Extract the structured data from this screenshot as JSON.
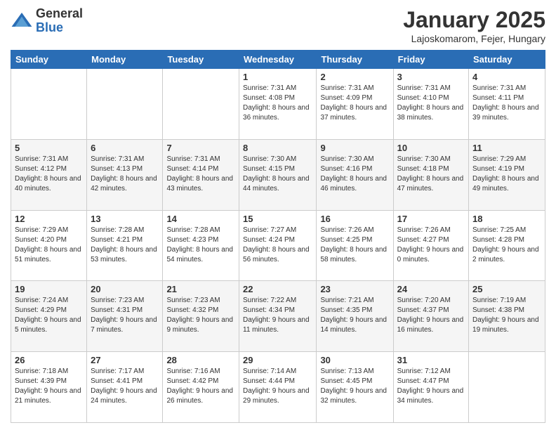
{
  "logo": {
    "general": "General",
    "blue": "Blue"
  },
  "title": "January 2025",
  "location": "Lajoskomarom, Fejer, Hungary",
  "days_of_week": [
    "Sunday",
    "Monday",
    "Tuesday",
    "Wednesday",
    "Thursday",
    "Friday",
    "Saturday"
  ],
  "weeks": [
    [
      {
        "day": "",
        "info": ""
      },
      {
        "day": "",
        "info": ""
      },
      {
        "day": "",
        "info": ""
      },
      {
        "day": "1",
        "info": "Sunrise: 7:31 AM\nSunset: 4:08 PM\nDaylight: 8 hours and 36 minutes."
      },
      {
        "day": "2",
        "info": "Sunrise: 7:31 AM\nSunset: 4:09 PM\nDaylight: 8 hours and 37 minutes."
      },
      {
        "day": "3",
        "info": "Sunrise: 7:31 AM\nSunset: 4:10 PM\nDaylight: 8 hours and 38 minutes."
      },
      {
        "day": "4",
        "info": "Sunrise: 7:31 AM\nSunset: 4:11 PM\nDaylight: 8 hours and 39 minutes."
      }
    ],
    [
      {
        "day": "5",
        "info": "Sunrise: 7:31 AM\nSunset: 4:12 PM\nDaylight: 8 hours and 40 minutes."
      },
      {
        "day": "6",
        "info": "Sunrise: 7:31 AM\nSunset: 4:13 PM\nDaylight: 8 hours and 42 minutes."
      },
      {
        "day": "7",
        "info": "Sunrise: 7:31 AM\nSunset: 4:14 PM\nDaylight: 8 hours and 43 minutes."
      },
      {
        "day": "8",
        "info": "Sunrise: 7:30 AM\nSunset: 4:15 PM\nDaylight: 8 hours and 44 minutes."
      },
      {
        "day": "9",
        "info": "Sunrise: 7:30 AM\nSunset: 4:16 PM\nDaylight: 8 hours and 46 minutes."
      },
      {
        "day": "10",
        "info": "Sunrise: 7:30 AM\nSunset: 4:18 PM\nDaylight: 8 hours and 47 minutes."
      },
      {
        "day": "11",
        "info": "Sunrise: 7:29 AM\nSunset: 4:19 PM\nDaylight: 8 hours and 49 minutes."
      }
    ],
    [
      {
        "day": "12",
        "info": "Sunrise: 7:29 AM\nSunset: 4:20 PM\nDaylight: 8 hours and 51 minutes."
      },
      {
        "day": "13",
        "info": "Sunrise: 7:28 AM\nSunset: 4:21 PM\nDaylight: 8 hours and 53 minutes."
      },
      {
        "day": "14",
        "info": "Sunrise: 7:28 AM\nSunset: 4:23 PM\nDaylight: 8 hours and 54 minutes."
      },
      {
        "day": "15",
        "info": "Sunrise: 7:27 AM\nSunset: 4:24 PM\nDaylight: 8 hours and 56 minutes."
      },
      {
        "day": "16",
        "info": "Sunrise: 7:26 AM\nSunset: 4:25 PM\nDaylight: 8 hours and 58 minutes."
      },
      {
        "day": "17",
        "info": "Sunrise: 7:26 AM\nSunset: 4:27 PM\nDaylight: 9 hours and 0 minutes."
      },
      {
        "day": "18",
        "info": "Sunrise: 7:25 AM\nSunset: 4:28 PM\nDaylight: 9 hours and 2 minutes."
      }
    ],
    [
      {
        "day": "19",
        "info": "Sunrise: 7:24 AM\nSunset: 4:29 PM\nDaylight: 9 hours and 5 minutes."
      },
      {
        "day": "20",
        "info": "Sunrise: 7:23 AM\nSunset: 4:31 PM\nDaylight: 9 hours and 7 minutes."
      },
      {
        "day": "21",
        "info": "Sunrise: 7:23 AM\nSunset: 4:32 PM\nDaylight: 9 hours and 9 minutes."
      },
      {
        "day": "22",
        "info": "Sunrise: 7:22 AM\nSunset: 4:34 PM\nDaylight: 9 hours and 11 minutes."
      },
      {
        "day": "23",
        "info": "Sunrise: 7:21 AM\nSunset: 4:35 PM\nDaylight: 9 hours and 14 minutes."
      },
      {
        "day": "24",
        "info": "Sunrise: 7:20 AM\nSunset: 4:37 PM\nDaylight: 9 hours and 16 minutes."
      },
      {
        "day": "25",
        "info": "Sunrise: 7:19 AM\nSunset: 4:38 PM\nDaylight: 9 hours and 19 minutes."
      }
    ],
    [
      {
        "day": "26",
        "info": "Sunrise: 7:18 AM\nSunset: 4:39 PM\nDaylight: 9 hours and 21 minutes."
      },
      {
        "day": "27",
        "info": "Sunrise: 7:17 AM\nSunset: 4:41 PM\nDaylight: 9 hours and 24 minutes."
      },
      {
        "day": "28",
        "info": "Sunrise: 7:16 AM\nSunset: 4:42 PM\nDaylight: 9 hours and 26 minutes."
      },
      {
        "day": "29",
        "info": "Sunrise: 7:14 AM\nSunset: 4:44 PM\nDaylight: 9 hours and 29 minutes."
      },
      {
        "day": "30",
        "info": "Sunrise: 7:13 AM\nSunset: 4:45 PM\nDaylight: 9 hours and 32 minutes."
      },
      {
        "day": "31",
        "info": "Sunrise: 7:12 AM\nSunset: 4:47 PM\nDaylight: 9 hours and 34 minutes."
      },
      {
        "day": "",
        "info": ""
      }
    ]
  ]
}
